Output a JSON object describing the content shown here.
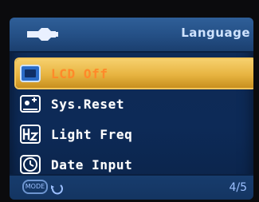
{
  "header": {
    "title": "Language"
  },
  "menu": {
    "items": [
      {
        "label": "LCD Off",
        "icon": "lcd-icon",
        "selected": true
      },
      {
        "label": "Sys.Reset",
        "icon": "system-reset-icon",
        "selected": false
      },
      {
        "label": "Light Freq",
        "icon": "hz-icon",
        "selected": false
      },
      {
        "label": "Date Input",
        "icon": "clock-icon",
        "selected": false
      }
    ]
  },
  "footer": {
    "mode_label": "MODE",
    "page_indicator": "4/5"
  },
  "colors": {
    "selected_bg": "#e7b441",
    "selected_text": "#ff8a2a",
    "header_bg": "#244f85",
    "screen_bg": "#0d2a57"
  }
}
